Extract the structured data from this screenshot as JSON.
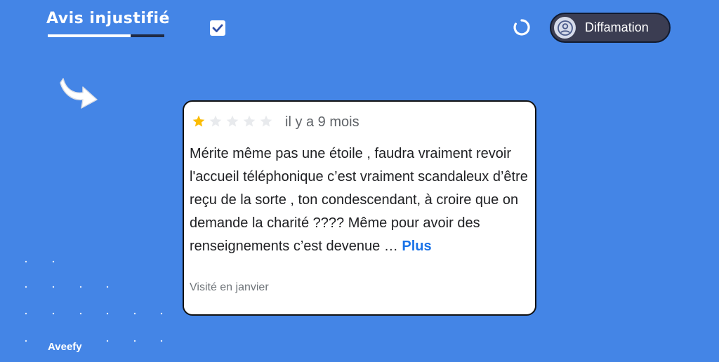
{
  "header": {
    "title": "Avis injustifié",
    "badge_label": "Diffamation",
    "brand": "Aveefy"
  },
  "review": {
    "rating": 1,
    "max_rating": 5,
    "age": "il y a 9 mois",
    "text": "Mérite même pas une étoile , faudra vraiment revoir l'accueil téléphonique c’est vraiment scandaleux d’être reçu de la sorte , ton condescendant, à croire que on demande la charité ???? Même pour avoir des renseignements c’est devenue …",
    "more_label": "Plus",
    "visited": "Visité en janvier"
  },
  "colors": {
    "background": "#4485e6",
    "star_filled": "#fbbc04",
    "star_empty": "#e8eaed",
    "link": "#1a73e8"
  },
  "icons": [
    "check-icon",
    "spinner-icon",
    "user-avatar-icon",
    "curved-arrow-icon",
    "star-icon"
  ]
}
